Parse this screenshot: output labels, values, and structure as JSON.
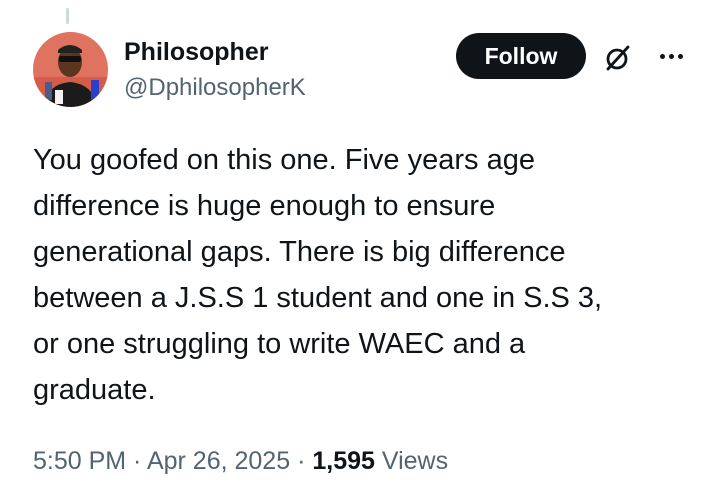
{
  "author": {
    "display_name": "Philosopher",
    "handle": "@DphilosopherK"
  },
  "actions": {
    "follow_label": "Follow",
    "grok_icon": "grok-slash-circle-icon",
    "more_icon": "more-dots-icon"
  },
  "tweet": {
    "text": "You goofed on this one. Five years age\ndifference is huge enough to ensure\ngenerational gaps. There is big difference\nbetween a J.S.S 1 student and one in S.S 3,\nor one struggling to write WAEC and a\ngraduate."
  },
  "meta": {
    "time": "5:50 PM",
    "separator1": " · ",
    "date": "Apr 26, 2025",
    "separator2": " · ",
    "views_count": "1,595",
    "views_label": " Views"
  },
  "colors": {
    "text_primary": "#0f1419",
    "text_secondary": "#536471",
    "follow_bg": "#0f1419",
    "avatar_bg": "#e0735f"
  }
}
